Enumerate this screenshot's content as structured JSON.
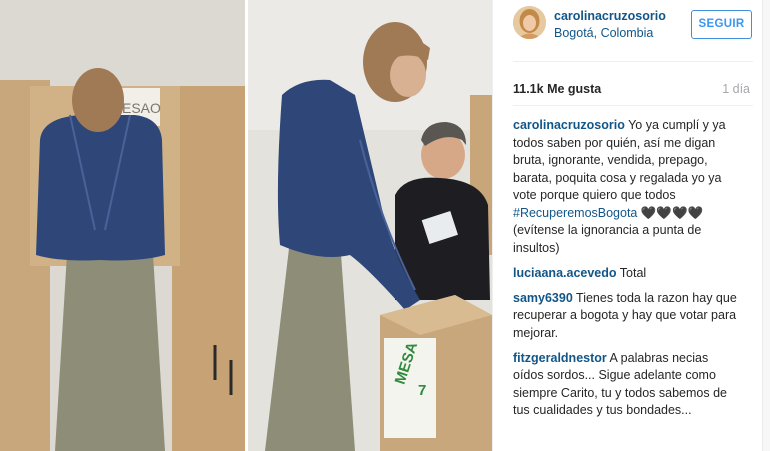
{
  "post": {
    "username": "carolinacruzosorio",
    "location": "Bogotá, Colombia",
    "follow_label": "SEGUIR",
    "likes": "11.1k Me gusta",
    "time_ago": "1 día",
    "ballot_box_label": "MESA",
    "ballot_box_number": "7",
    "booth_sign": "ESAO"
  },
  "comments": [
    {
      "user": "carolinacruzosorio",
      "text_before": " Yo ya cumplí y ya todos saben por quién, así me digan bruta, ignorante, vendida, prepago, barata, poquita cosa y regalada yo ya vote porque quiero que todos ",
      "hashtag": "#RecuperemosBogota",
      "text_after": " 🖤🖤🖤🖤 (evítense la ignorancia a punta de insultos)"
    },
    {
      "user": "luciaana.acevedo",
      "text_before": " Total",
      "hashtag": "",
      "text_after": ""
    },
    {
      "user": "samy6390",
      "text_before": " Tienes toda la razon hay que recuperar a bogota y hay que votar para mejorar.",
      "hashtag": "",
      "text_after": ""
    },
    {
      "user": "fitzgeraldnestor",
      "text_before": " A palabras necias oídos sordos... Sigue adelante como siempre Carito, tu y todos sabemos de tus cualidades y tus bondades...",
      "hashtag": "",
      "text_after": ""
    }
  ],
  "colors": {
    "link": "#125688",
    "follow_border": "#4090db",
    "muted": "#a5a7aa",
    "jacket": "#2e4778",
    "skirt": "#8d8d78",
    "cardboard": "#c9a77c",
    "mesa_green": "#2f8a3e"
  }
}
